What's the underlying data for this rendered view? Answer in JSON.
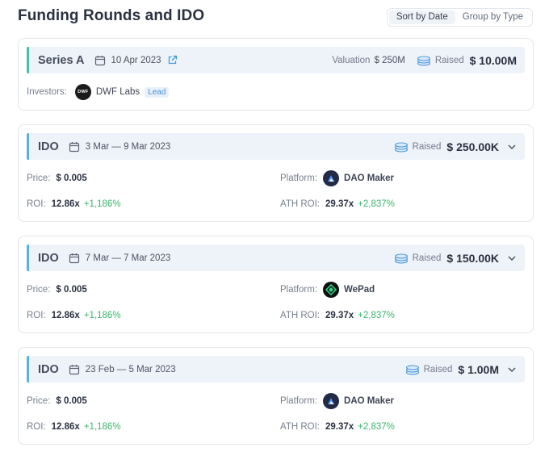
{
  "page": {
    "title": "Funding Rounds and IDO",
    "sort_options": [
      "Sort by Date",
      "Group by Type"
    ],
    "active_sort": "Sort by Date"
  },
  "labels": {
    "valuation": "Valuation",
    "raised": "Raised",
    "investors": "Investors:",
    "price": "Price:",
    "platform": "Platform:",
    "roi": "ROI:",
    "ath_roi": "ATH ROI:"
  },
  "series_a": {
    "type": "Series A",
    "date": "10 Apr 2023",
    "valuation": "$ 250M",
    "raised": "$ 10.00M",
    "investor": {
      "name": "DWF Labs",
      "badge": "Lead",
      "logo_text": "DWF"
    }
  },
  "idos": [
    {
      "type": "IDO",
      "dates": "3 Mar — 9 Mar 2023",
      "raised": "$ 250.00K",
      "price": "$ 0.005",
      "platform": "DAO Maker",
      "roi": "12.86x",
      "roi_pct": "+1,186%",
      "ath_roi": "29.37x",
      "ath_roi_pct": "+2,837%"
    },
    {
      "type": "IDO",
      "dates": "7 Mar — 7 Mar 2023",
      "raised": "$ 150.00K",
      "price": "$ 0.005",
      "platform": "WePad",
      "roi": "12.86x",
      "roi_pct": "+1,186%",
      "ath_roi": "29.37x",
      "ath_roi_pct": "+2,837%"
    },
    {
      "type": "IDO",
      "dates": "23 Feb — 5 Mar 2023",
      "raised": "$ 1.00M",
      "price": "$ 0.005",
      "platform": "DAO Maker",
      "roi": "12.86x",
      "roi_pct": "+1,186%",
      "ath_roi": "29.37x",
      "ath_roi_pct": "+2,837%"
    }
  ],
  "colors": {
    "series_accent": "#49c0a3",
    "ido_accent": "#5ab0e6",
    "positive": "#3bb56c",
    "badge_blue": "#4b8fd6"
  }
}
